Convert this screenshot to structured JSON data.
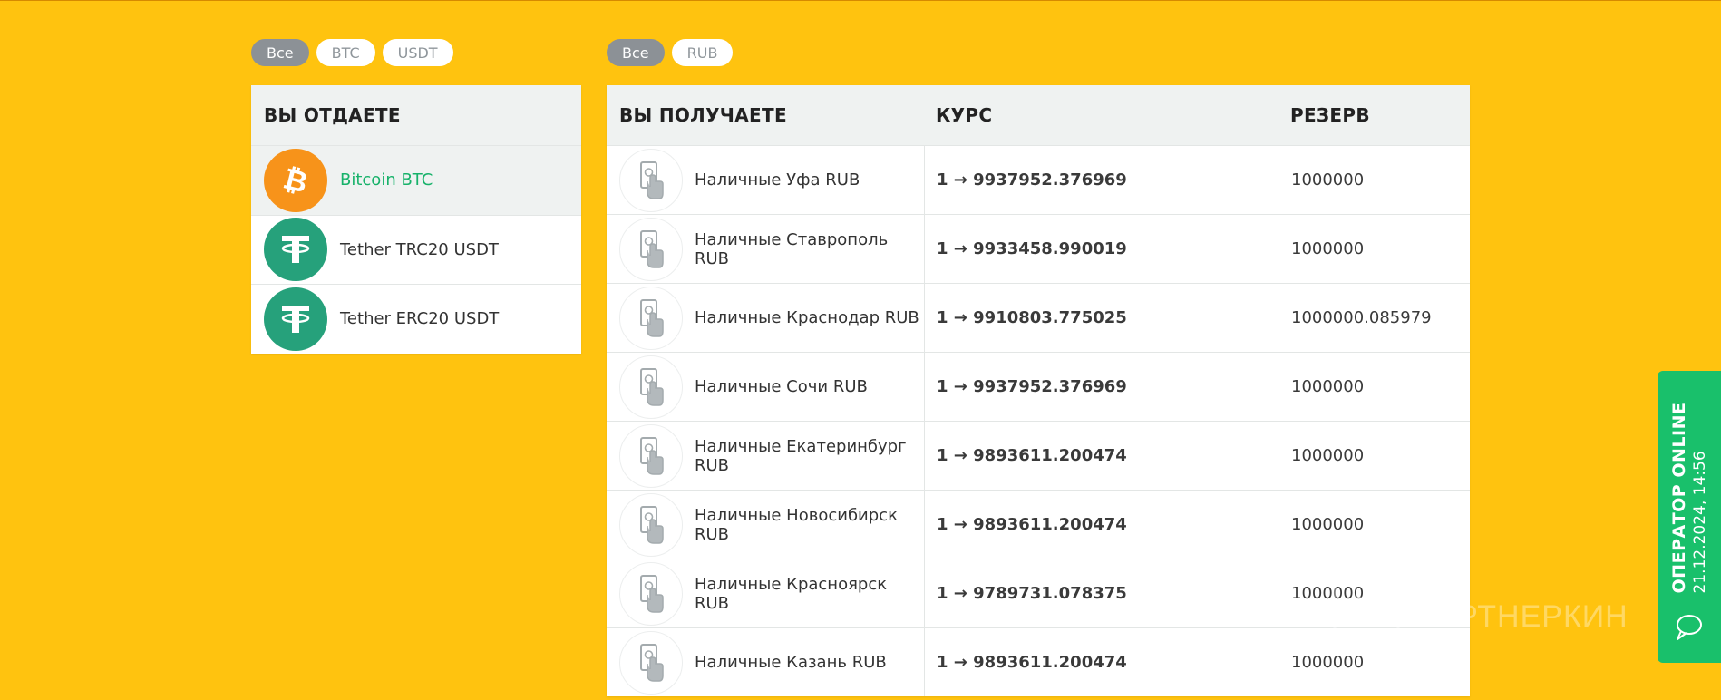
{
  "left_filters": [
    {
      "label": "Все",
      "active": true
    },
    {
      "label": "BTC",
      "active": false
    },
    {
      "label": "USDT",
      "active": false
    }
  ],
  "right_filters": [
    {
      "label": "Все",
      "active": true
    },
    {
      "label": "RUB",
      "active": false
    }
  ],
  "give": {
    "header": "ВЫ ОТДАЕТЕ",
    "items": [
      {
        "name": "Bitcoin BTC",
        "icon": "bitcoin-icon",
        "selected": true
      },
      {
        "name": "Tether TRC20 USDT",
        "icon": "tether-icon",
        "selected": false
      },
      {
        "name": "Tether ERC20 USDT",
        "icon": "tether-icon",
        "selected": false
      }
    ]
  },
  "get": {
    "headers": {
      "receive": "ВЫ ПОЛУЧАЕТЕ",
      "rate": "КУРС",
      "reserve": "РЕЗЕРВ"
    },
    "rows": [
      {
        "name": "Наличные Уфа RUB",
        "rate": "1 → 9937952.376969",
        "reserve": "1000000"
      },
      {
        "name": "Наличные Ставрополь RUB",
        "rate": "1 → 9933458.990019",
        "reserve": "1000000"
      },
      {
        "name": "Наличные Краснодар RUB",
        "rate": "1 → 9910803.775025",
        "reserve": "1000000.085979"
      },
      {
        "name": "Наличные Сочи RUB",
        "rate": "1 → 9937952.376969",
        "reserve": "1000000"
      },
      {
        "name": "Наличные Екатеринбург RUB",
        "rate": "1 → 9893611.200474",
        "reserve": "1000000"
      },
      {
        "name": "Наличные Новосибирск RUB",
        "rate": "1 → 9893611.200474",
        "reserve": "1000000"
      },
      {
        "name": "Наличные Красноярск RUB",
        "rate": "1 → 9789731.078375",
        "reserve": "1000000"
      },
      {
        "name": "Наличные Казань RUB",
        "rate": "1 → 9893611.200474",
        "reserve": "1000000"
      }
    ]
  },
  "operator": {
    "title": "ОПЕРАТОР ONLINE",
    "time": "21.12.2024, 14:56",
    "icon": "chat-icon"
  },
  "watermark": {
    "text": "ПАРТНЕРКИН"
  },
  "colors": {
    "background": "#FFC30F",
    "accent_green": "#17B26A",
    "bitcoin": "#F7931A",
    "tether": "#26A17B"
  }
}
